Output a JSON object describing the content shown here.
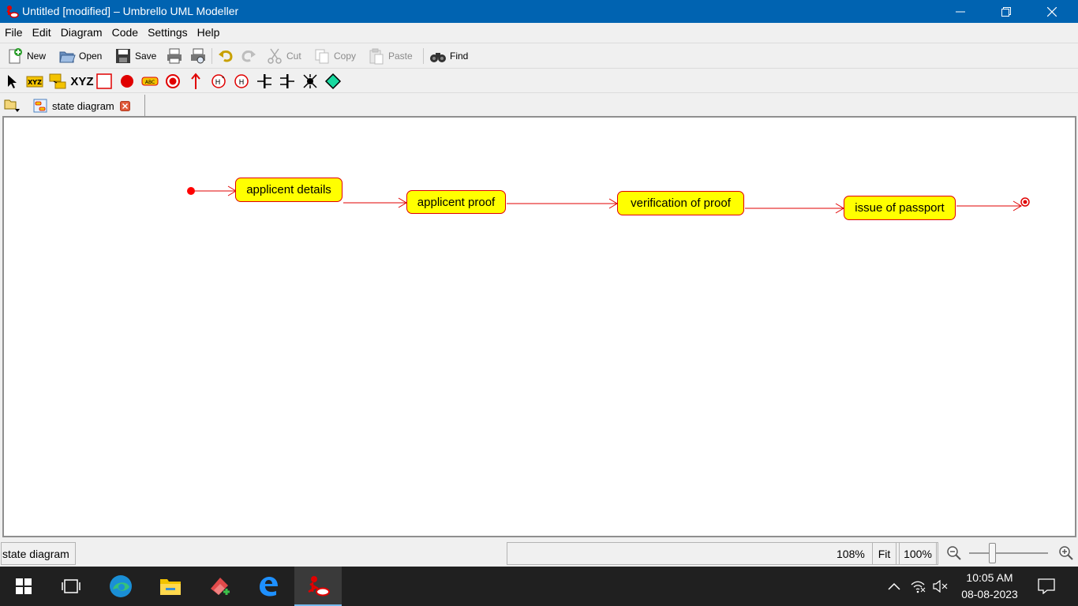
{
  "window": {
    "title": "Untitled [modified] – Umbrello UML Modeller"
  },
  "menu": [
    "File",
    "Edit",
    "Diagram",
    "Code",
    "Settings",
    "Help"
  ],
  "toolbar": {
    "new": "New",
    "open": "Open",
    "save": "Save",
    "cut": "Cut",
    "copy": "Copy",
    "paste": "Paste",
    "find": "Find"
  },
  "diagram_toolbar": {
    "text_tool": "XYZ"
  },
  "tabs": [
    {
      "label": "state diagram"
    }
  ],
  "diagram": {
    "states": [
      {
        "label": "applicent details"
      },
      {
        "label": "applicent proof"
      },
      {
        "label": "verification of proof"
      },
      {
        "label": "issue of passport"
      }
    ],
    "colors": {
      "state_fill": "#ffff00",
      "state_border": "#e00000",
      "transition": "#e00000"
    }
  },
  "statusbar": {
    "text": "state diagram",
    "zoom": "108%",
    "fit": "Fit",
    "hundred": "100%"
  },
  "taskbar": {
    "time": "10:05 AM",
    "date": "08-08-2023"
  },
  "colors": {
    "titlebar": "#0063b1",
    "taskbar": "#202020"
  }
}
